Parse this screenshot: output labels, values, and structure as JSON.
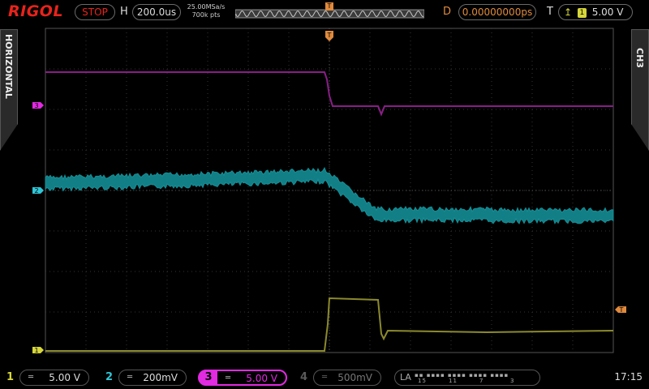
{
  "top": {
    "brand": "RIGOL",
    "run_state": "STOP",
    "h_label": "H",
    "timebase": "200.0us",
    "sample_rate": "25.00MSa/s",
    "memory_depth": "700k pts",
    "d_label": "D",
    "delay": "0.00000000ps",
    "t_label": "T",
    "trigger_source": "1",
    "trigger_level": "5.00 V",
    "trigger_marker": "T"
  },
  "side": {
    "left_tab": "HORIZONTAL",
    "right_tab": "CH3"
  },
  "markers": {
    "ch3": "3",
    "ch2": "2",
    "ch1": "1",
    "trigger_level": "T",
    "trigger_pos": "T"
  },
  "channels": [
    {
      "num": "1",
      "coupling": "DC",
      "scale": "5.00 V",
      "color": "#d6d63a",
      "active": false
    },
    {
      "num": "2",
      "coupling": "DC",
      "scale": "200mV",
      "color": "#2fc6d6",
      "active": false
    },
    {
      "num": "3",
      "coupling": "DC",
      "scale": "5.00 V",
      "color": "#e22ae2",
      "active": true
    },
    {
      "num": "4",
      "coupling": "DC",
      "scale": "500mV",
      "color": "#5a5a5a",
      "active": false
    }
  ],
  "la": {
    "label": "LA",
    "ticks": [
      "15",
      "11",
      "7",
      "3"
    ]
  },
  "clock": "17:15",
  "colors": {
    "ch1": "#8c8a2c",
    "ch2": "#127f86",
    "ch3": "#8a1e88",
    "grid": "#3b3b3b",
    "stop": "#e8231b",
    "delay": "#e08a3c",
    "trigger": "#e08a3c"
  }
}
